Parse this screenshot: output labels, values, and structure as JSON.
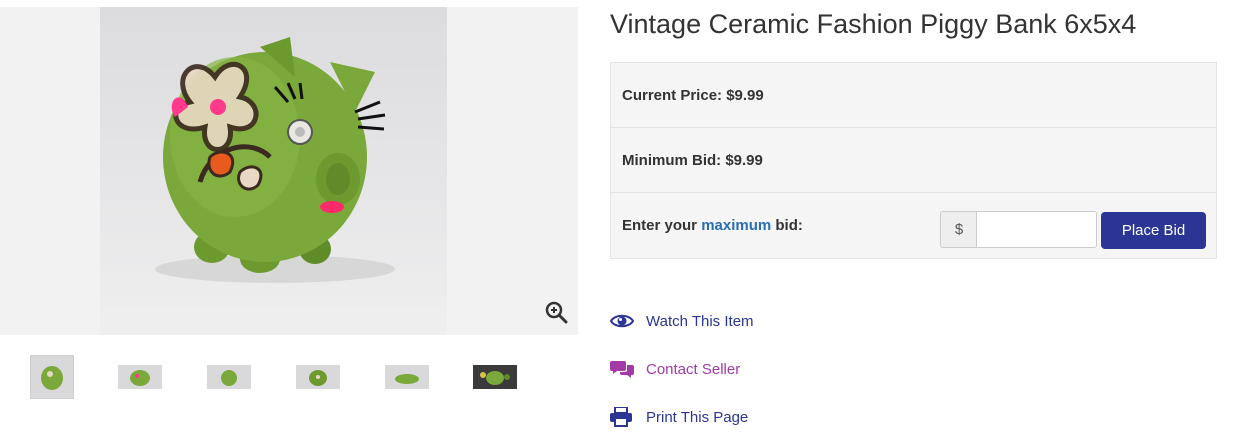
{
  "item": {
    "title": "Vintage Ceramic Fashion Piggy Bank 6x5x4"
  },
  "gallery": {
    "thumbnail_count": 6,
    "zoom_icon": "zoom-in-icon"
  },
  "bidding": {
    "current_price_label": "Current Price: $9.99",
    "minimum_bid_label": "Minimum Bid: $9.99",
    "enter_bid_prefix": "Enter your",
    "enter_bid_link": "maximum",
    "enter_bid_suffix": "bid:",
    "currency_symbol": "$",
    "bid_input_value": "",
    "bid_input_placeholder": "",
    "place_bid_label": "Place Bid"
  },
  "actions": {
    "watch_label": "Watch This Item",
    "watch_icon": "eye-icon",
    "contact_label": "Contact Seller",
    "contact_icon": "chat-bubbles-icon",
    "print_label": "Print This Page",
    "print_icon": "printer-icon"
  },
  "colors": {
    "primary_button": "#2b3593",
    "link_blue": "#2a6fb0",
    "contact_purple": "#a33aa8",
    "panel_bg": "#f5f5f5"
  }
}
